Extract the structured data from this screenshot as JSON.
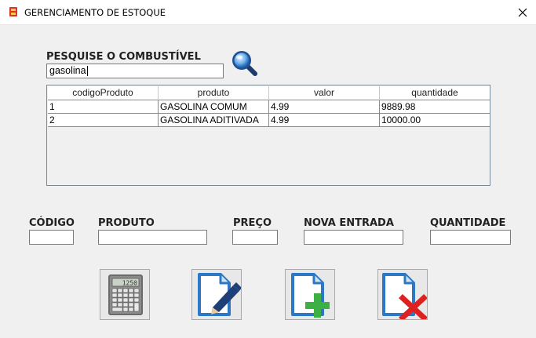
{
  "window": {
    "title": "GERENCIAMENTO DE ESTOQUE"
  },
  "search": {
    "label": "PESQUISE O COMBUSTÍVEL",
    "value": "gasolina"
  },
  "table": {
    "columns": [
      "codigoProduto",
      "produto",
      "valor",
      "quantidade"
    ],
    "rows": [
      [
        "1",
        "GASOLINA COMUM",
        "4.99",
        "9889.98"
      ],
      [
        "2",
        "GASOLINA ADITIVADA",
        "4.99",
        "10000.00"
      ]
    ]
  },
  "form": {
    "codigo_label": "CÓDIGO",
    "produto_label": "PRODUTO",
    "preco_label": "PREÇO",
    "nova_entrada_label": "NOVA ENTRADA",
    "quantidade_label": "QUANTIDADE",
    "codigo_value": "",
    "produto_value": "",
    "preco_value": "",
    "nova_entrada_value": "",
    "quantidade_value": ""
  },
  "calculator_display": "1250",
  "icons": {
    "app": "app-icon",
    "close": "close-icon",
    "search": "magnifier-icon",
    "calculator": "calculator-icon",
    "edit": "edit-document-icon",
    "add": "add-document-icon",
    "delete": "delete-document-icon"
  }
}
